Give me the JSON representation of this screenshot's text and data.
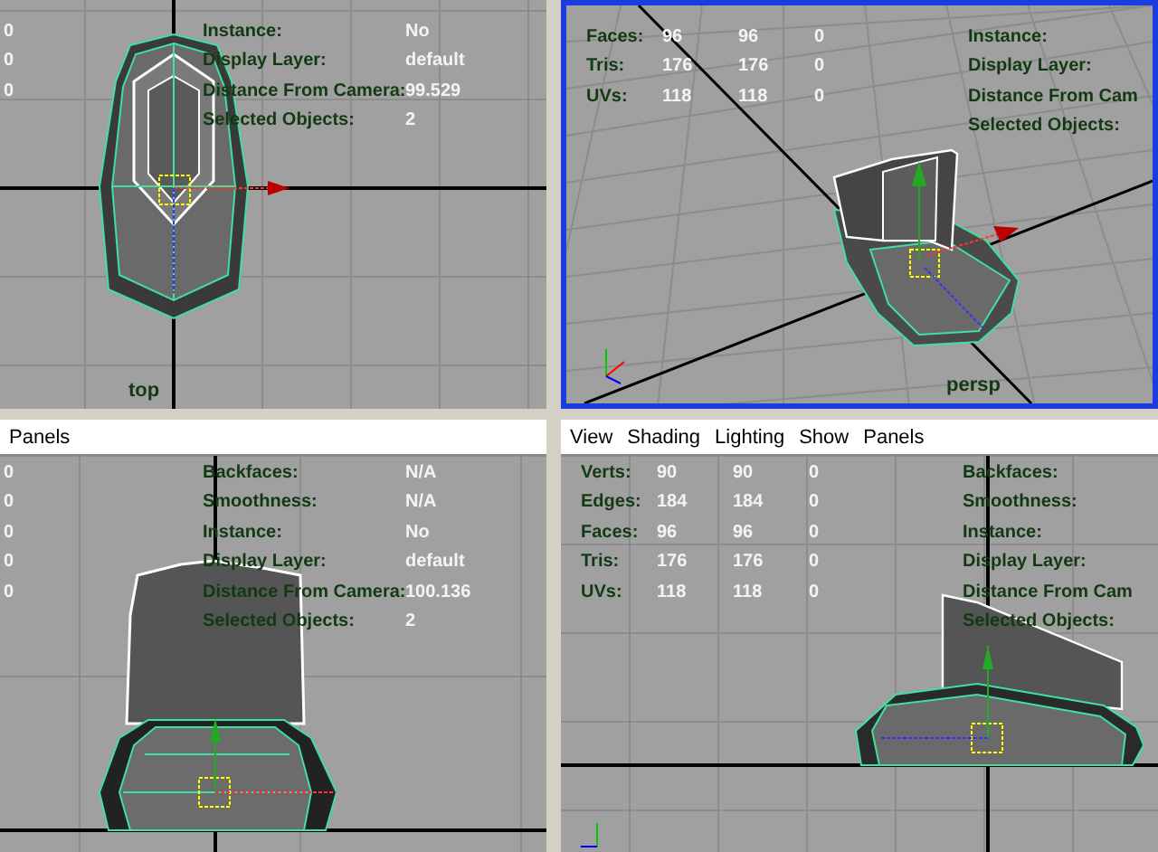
{
  "viewports": [
    {
      "camera": "top",
      "active": false,
      "stats": [
        {
          "cells": [
            "0"
          ]
        },
        {
          "cells": [
            "0"
          ]
        },
        {
          "cells": [
            "0"
          ]
        }
      ],
      "info": [
        {
          "label": "Instance:",
          "value": "No"
        },
        {
          "label": "Display Layer:",
          "value": "default"
        },
        {
          "label": "Distance From Camera:",
          "value": "99.529"
        },
        {
          "label": "Selected Objects:",
          "value": "2"
        }
      ]
    },
    {
      "camera": "persp",
      "active": true,
      "stats": [
        {
          "cells": [
            "Faces:",
            "96",
            "96",
            "0"
          ]
        },
        {
          "cells": [
            "Tris:",
            "176",
            "176",
            "0"
          ]
        },
        {
          "cells": [
            "UVs:",
            "118",
            "118",
            "0"
          ]
        }
      ],
      "info": [
        {
          "label": "Instance:"
        },
        {
          "label": "Display Layer:"
        },
        {
          "label": "Distance From Cam"
        },
        {
          "label": "Selected Objects:"
        }
      ]
    },
    {
      "active": false,
      "menu": [
        "Panels"
      ],
      "stats": [
        {
          "cells": [
            "0"
          ]
        },
        {
          "cells": [
            "0"
          ]
        },
        {
          "cells": [
            "0"
          ]
        },
        {
          "cells": [
            "0"
          ]
        },
        {
          "cells": [
            "0"
          ]
        }
      ],
      "info": [
        {
          "label": "Backfaces:",
          "value": "N/A"
        },
        {
          "label": "Smoothness:",
          "value": "N/A"
        },
        {
          "label": "Instance:",
          "value": "No"
        },
        {
          "label": "Display Layer:",
          "value": "default"
        },
        {
          "label": "Distance From Camera:",
          "value": "100.136"
        },
        {
          "label": "Selected Objects:",
          "value": "2"
        }
      ]
    },
    {
      "active": false,
      "menu": [
        "View",
        "Shading",
        "Lighting",
        "Show",
        "Panels"
      ],
      "stats": [
        {
          "cells": [
            "Verts:",
            "90",
            "90",
            "0"
          ]
        },
        {
          "cells": [
            "Edges:",
            "184",
            "184",
            "0"
          ]
        },
        {
          "cells": [
            "Faces:",
            "96",
            "96",
            "0"
          ]
        },
        {
          "cells": [
            "Tris:",
            "176",
            "176",
            "0"
          ]
        },
        {
          "cells": [
            "UVs:",
            "118",
            "118",
            "0"
          ]
        }
      ],
      "info": [
        {
          "label": "Backfaces:"
        },
        {
          "label": "Smoothness:"
        },
        {
          "label": "Instance:"
        },
        {
          "label": "Display Layer:"
        },
        {
          "label": "Distance From Cam"
        },
        {
          "label": "Selected Objects:"
        }
      ]
    }
  ]
}
